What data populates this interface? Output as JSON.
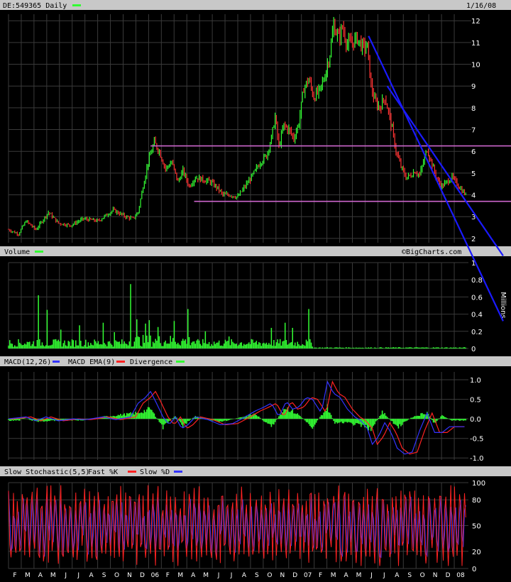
{
  "header": {
    "symbol": "DE:549365 Daily",
    "date": "1/16/08"
  },
  "watermark": "©BigCharts.com",
  "colors": {
    "up": "#33ff33",
    "down": "#ff3333",
    "trend": "#1a1aff",
    "support": "#cc66cc",
    "macd": "#3333ff",
    "ema": "#ff2222",
    "divergence": "#33ff33",
    "fastk": "#ff2222",
    "slowd": "#3333ff",
    "grid": "#3a3a3a",
    "bar": "#cccccc"
  },
  "chart_data": [
    {
      "type": "line",
      "title": "DE:549365 Daily",
      "ylim": [
        1.8,
        12.3
      ],
      "y_ticks": [
        2,
        3,
        4,
        5,
        6,
        7,
        8,
        9,
        10,
        11,
        12
      ],
      "x_labels": [
        "F",
        "M",
        "A",
        "M",
        "J",
        "J",
        "A",
        "S",
        "O",
        "N",
        "D",
        "06",
        "F",
        "M",
        "A",
        "M",
        "J",
        "J",
        "A",
        "S",
        "O",
        "N",
        "D",
        "07",
        "F",
        "M",
        "A",
        "M",
        "J",
        "J",
        "A",
        "S",
        "O",
        "N",
        "D",
        "08"
      ],
      "price_path": [
        [
          0,
          2.4
        ],
        [
          8,
          2.2
        ],
        [
          14,
          2.8
        ],
        [
          22,
          2.4
        ],
        [
          32,
          3.2
        ],
        [
          40,
          2.7
        ],
        [
          50,
          2.6
        ],
        [
          60,
          2.9
        ],
        [
          72,
          2.8
        ],
        [
          84,
          3.3
        ],
        [
          94,
          3.0
        ],
        [
          100,
          2.9
        ],
        [
          104,
          3.2
        ],
        [
          108,
          4.4
        ],
        [
          112,
          5.5
        ],
        [
          117,
          6.4
        ],
        [
          121,
          6.0
        ],
        [
          126,
          5.2
        ],
        [
          131,
          5.5
        ],
        [
          136,
          4.6
        ],
        [
          140,
          5.1
        ],
        [
          145,
          4.4
        ],
        [
          150,
          4.8
        ],
        [
          156,
          4.7
        ],
        [
          162,
          4.6
        ],
        [
          168,
          4.3
        ],
        [
          172,
          4.0
        ],
        [
          178,
          4.0
        ],
        [
          184,
          3.9
        ],
        [
          190,
          4.4
        ],
        [
          196,
          4.9
        ],
        [
          202,
          5.5
        ],
        [
          207,
          5.8
        ],
        [
          211,
          6.6
        ],
        [
          214,
          7.6
        ],
        [
          217,
          6.2
        ],
        [
          221,
          7.2
        ],
        [
          225,
          7.0
        ],
        [
          229,
          6.6
        ],
        [
          233,
          7.3
        ],
        [
          237,
          8.9
        ],
        [
          241,
          9.3
        ],
        [
          245,
          8.5
        ],
        [
          250,
          8.8
        ],
        [
          254,
          9.5
        ],
        [
          258,
          10.5
        ],
        [
          261,
          11.8
        ],
        [
          265,
          11.2
        ],
        [
          268,
          11.7
        ],
        [
          272,
          10.9
        ],
        [
          276,
          11.0
        ],
        [
          280,
          11.2
        ],
        [
          284,
          10.8
        ],
        [
          288,
          10.8
        ],
        [
          291,
          9.0
        ],
        [
          294,
          8.3
        ],
        [
          298,
          8.0
        ],
        [
          302,
          8.5
        ],
        [
          305,
          7.8
        ],
        [
          308,
          7.0
        ],
        [
          311,
          6.0
        ],
        [
          315,
          5.3
        ],
        [
          319,
          4.8
        ],
        [
          323,
          4.9
        ],
        [
          326,
          5.1
        ],
        [
          330,
          4.9
        ],
        [
          333,
          5.5
        ],
        [
          336,
          6.1
        ],
        [
          340,
          5.4
        ],
        [
          344,
          4.7
        ],
        [
          348,
          4.4
        ],
        [
          352,
          4.6
        ],
        [
          356,
          4.8
        ],
        [
          360,
          4.5
        ],
        [
          364,
          4.2
        ],
        [
          367,
          4.0
        ]
      ],
      "trendlines": [
        {
          "points": [
            [
              289,
              11.3
            ],
            [
              397,
              -1.8
            ]
          ]
        },
        {
          "points": [
            [
              304,
              9.0
            ],
            [
              397,
              1.2
            ]
          ]
        }
      ],
      "support_lines": [
        6.25,
        3.7
      ],
      "support_starts": [
        114,
        149
      ]
    },
    {
      "type": "bar",
      "title": "Volume",
      "ylabel": "Millions",
      "ylim": [
        0,
        1.0
      ],
      "y_ticks": [
        0,
        0.2,
        0.4,
        0.6,
        0.8,
        1
      ],
      "spikes": [
        [
          24,
          0.62
        ],
        [
          31,
          0.45
        ],
        [
          42,
          0.22
        ],
        [
          57,
          0.27
        ],
        [
          76,
          0.3
        ],
        [
          85,
          0.19
        ],
        [
          98,
          0.75
        ],
        [
          103,
          0.34
        ],
        [
          110,
          0.29
        ],
        [
          113,
          0.33
        ],
        [
          120,
          0.25
        ],
        [
          133,
          0.32
        ],
        [
          144,
          0.46
        ],
        [
          158,
          0.2
        ],
        [
          177,
          0.14
        ],
        [
          211,
          0.24
        ],
        [
          222,
          0.3
        ],
        [
          228,
          0.24
        ],
        [
          241,
          0.46
        ]
      ]
    },
    {
      "type": "line",
      "title": "MACD(12,26)",
      "legend": [
        "MACD EMA(9)",
        "Divergence"
      ],
      "ylim": [
        -1.05,
        1.2
      ],
      "y_ticks": [
        1.0,
        0.5,
        0.0,
        -0.5,
        -1.0
      ],
      "y_tick_labels": [
        "1.0",
        "0.5",
        "0.0",
        "-0.5",
        "-1.0"
      ],
      "macd_path": [
        [
          0,
          0
        ],
        [
          14,
          0.05
        ],
        [
          22,
          -0.05
        ],
        [
          30,
          0.05
        ],
        [
          40,
          -0.05
        ],
        [
          52,
          0
        ],
        [
          62,
          -0.02
        ],
        [
          76,
          0.05
        ],
        [
          86,
          -0.02
        ],
        [
          98,
          0.05
        ],
        [
          104,
          0.4
        ],
        [
          110,
          0.55
        ],
        [
          114,
          0.7
        ],
        [
          118,
          0.45
        ],
        [
          124,
          0.05
        ],
        [
          129,
          -0.15
        ],
        [
          134,
          0.05
        ],
        [
          139,
          -0.25
        ],
        [
          144,
          -0.15
        ],
        [
          150,
          0.05
        ],
        [
          160,
          -0.02
        ],
        [
          170,
          -0.15
        ],
        [
          180,
          -0.12
        ],
        [
          190,
          0.05
        ],
        [
          198,
          0.2
        ],
        [
          205,
          0.3
        ],
        [
          211,
          0.4
        ],
        [
          217,
          0.05
        ],
        [
          223,
          0.45
        ],
        [
          228,
          0.25
        ],
        [
          233,
          0.3
        ],
        [
          239,
          0.55
        ],
        [
          244,
          0.5
        ],
        [
          251,
          0.15
        ],
        [
          256,
          0.95
        ],
        [
          261,
          0.65
        ],
        [
          266,
          0.55
        ],
        [
          272,
          0.25
        ],
        [
          278,
          0.05
        ],
        [
          283,
          -0.05
        ],
        [
          288,
          -0.25
        ],
        [
          292,
          -0.65
        ],
        [
          297,
          -0.45
        ],
        [
          302,
          -0.1
        ],
        [
          307,
          -0.35
        ],
        [
          312,
          -0.75
        ],
        [
          318,
          -0.9
        ],
        [
          324,
          -0.85
        ],
        [
          330,
          -0.3
        ],
        [
          336,
          0.15
        ],
        [
          342,
          -0.35
        ],
        [
          348,
          -0.35
        ],
        [
          354,
          -0.2
        ],
        [
          360,
          -0.2
        ],
        [
          367,
          -0.2
        ]
      ],
      "ema_offset": 4,
      "divergence_bars": [
        [
          10,
          0.05
        ],
        [
          22,
          -0.08
        ],
        [
          40,
          -0.05
        ],
        [
          60,
          -0.04
        ],
        [
          76,
          0.06
        ],
        [
          104,
          0.18
        ],
        [
          114,
          0.3
        ],
        [
          124,
          -0.25
        ],
        [
          134,
          0.1
        ],
        [
          140,
          -0.2
        ],
        [
          150,
          0.08
        ],
        [
          170,
          -0.1
        ],
        [
          190,
          0.08
        ],
        [
          198,
          0.15
        ],
        [
          211,
          -0.25
        ],
        [
          222,
          0.35
        ],
        [
          233,
          0.12
        ],
        [
          244,
          -0.25
        ],
        [
          256,
          0.35
        ],
        [
          262,
          -0.15
        ],
        [
          270,
          -0.1
        ],
        [
          282,
          -0.2
        ],
        [
          292,
          -0.3
        ],
        [
          300,
          0.22
        ],
        [
          312,
          -0.25
        ],
        [
          324,
          0.05
        ],
        [
          336,
          0.2
        ],
        [
          342,
          -0.15
        ],
        [
          348,
          0.1
        ],
        [
          356,
          -0.05
        ]
      ]
    },
    {
      "type": "line",
      "title": "Slow Stochastic(5,5)",
      "legend": [
        "Fast %K",
        "Slow %D"
      ],
      "ylim": [
        0,
        100
      ],
      "y_ticks": [
        0,
        20,
        50,
        80,
        100
      ],
      "seed": 7,
      "cycles": 96
    }
  ]
}
